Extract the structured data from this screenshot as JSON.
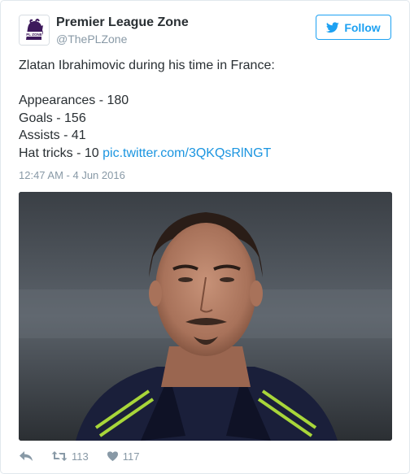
{
  "account": {
    "name": "Premier League Zone",
    "handle": "@ThePLZone",
    "avatar_icon": "premier-league-lion-logo-icon"
  },
  "follow_button": {
    "label": "Follow",
    "icon": "twitter-bird-icon",
    "color": "#1da1f2"
  },
  "tweet": {
    "lines": [
      "Zlatan Ibrahimovic during his time in France:",
      "",
      "Appearances - 180",
      "Goals - 156",
      "Assists - 41",
      "Hat tricks - 10"
    ],
    "link": "pic.twitter.com/3QKQsRlNGT",
    "link_color": "#1b95e0",
    "timestamp": "12:47 AM - 4 Jun 2016"
  },
  "media": {
    "description": "photo"
  },
  "actions": {
    "reply_icon": "reply-icon",
    "retweet_icon": "retweet-icon",
    "retweet_count": "113",
    "like_icon": "heart-icon",
    "like_count": "117"
  }
}
